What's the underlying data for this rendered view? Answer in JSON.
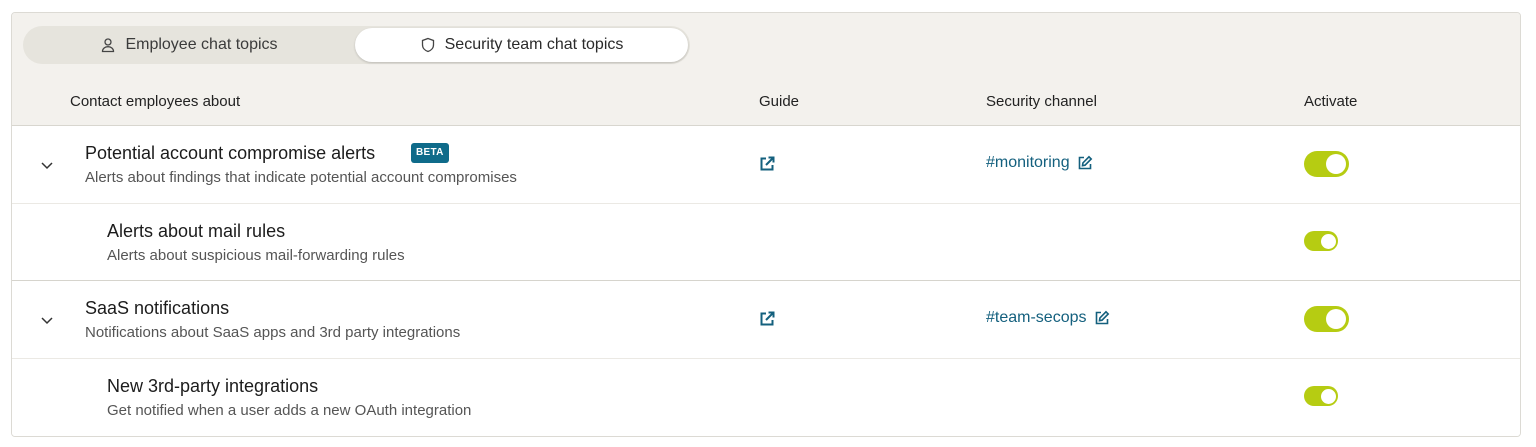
{
  "tabs": [
    {
      "label": "Employee chat topics",
      "icon": "user-icon",
      "selected": false
    },
    {
      "label": "Security team chat topics",
      "icon": "shield-icon",
      "selected": true
    }
  ],
  "columns": {
    "contact": "Contact employees about",
    "guide": "Guide",
    "channel": "Security channel",
    "activate": "Activate"
  },
  "rows": [
    {
      "title": "Potential account compromise alerts",
      "badge": "BETA",
      "description": "Alerts about findings that indicate potential account compromises",
      "channel": "#monitoring",
      "active": true,
      "children": [
        {
          "title": "Alerts about mail rules",
          "description": "Alerts about suspicious mail-forwarding rules",
          "active": true
        }
      ]
    },
    {
      "title": "SaaS notifications",
      "description": "Notifications about SaaS apps and 3rd party integrations",
      "channel": "#team-secops",
      "active": true,
      "children": [
        {
          "title": "New 3rd-party integrations",
          "description": "Get notified when a user adds a new OAuth integration",
          "active": true
        }
      ]
    }
  ],
  "colors": {
    "accent": "#14607e",
    "toggle_on": "#b6cc12",
    "badge": "#0f6b8a",
    "header_bg": "#f3f1ed"
  }
}
